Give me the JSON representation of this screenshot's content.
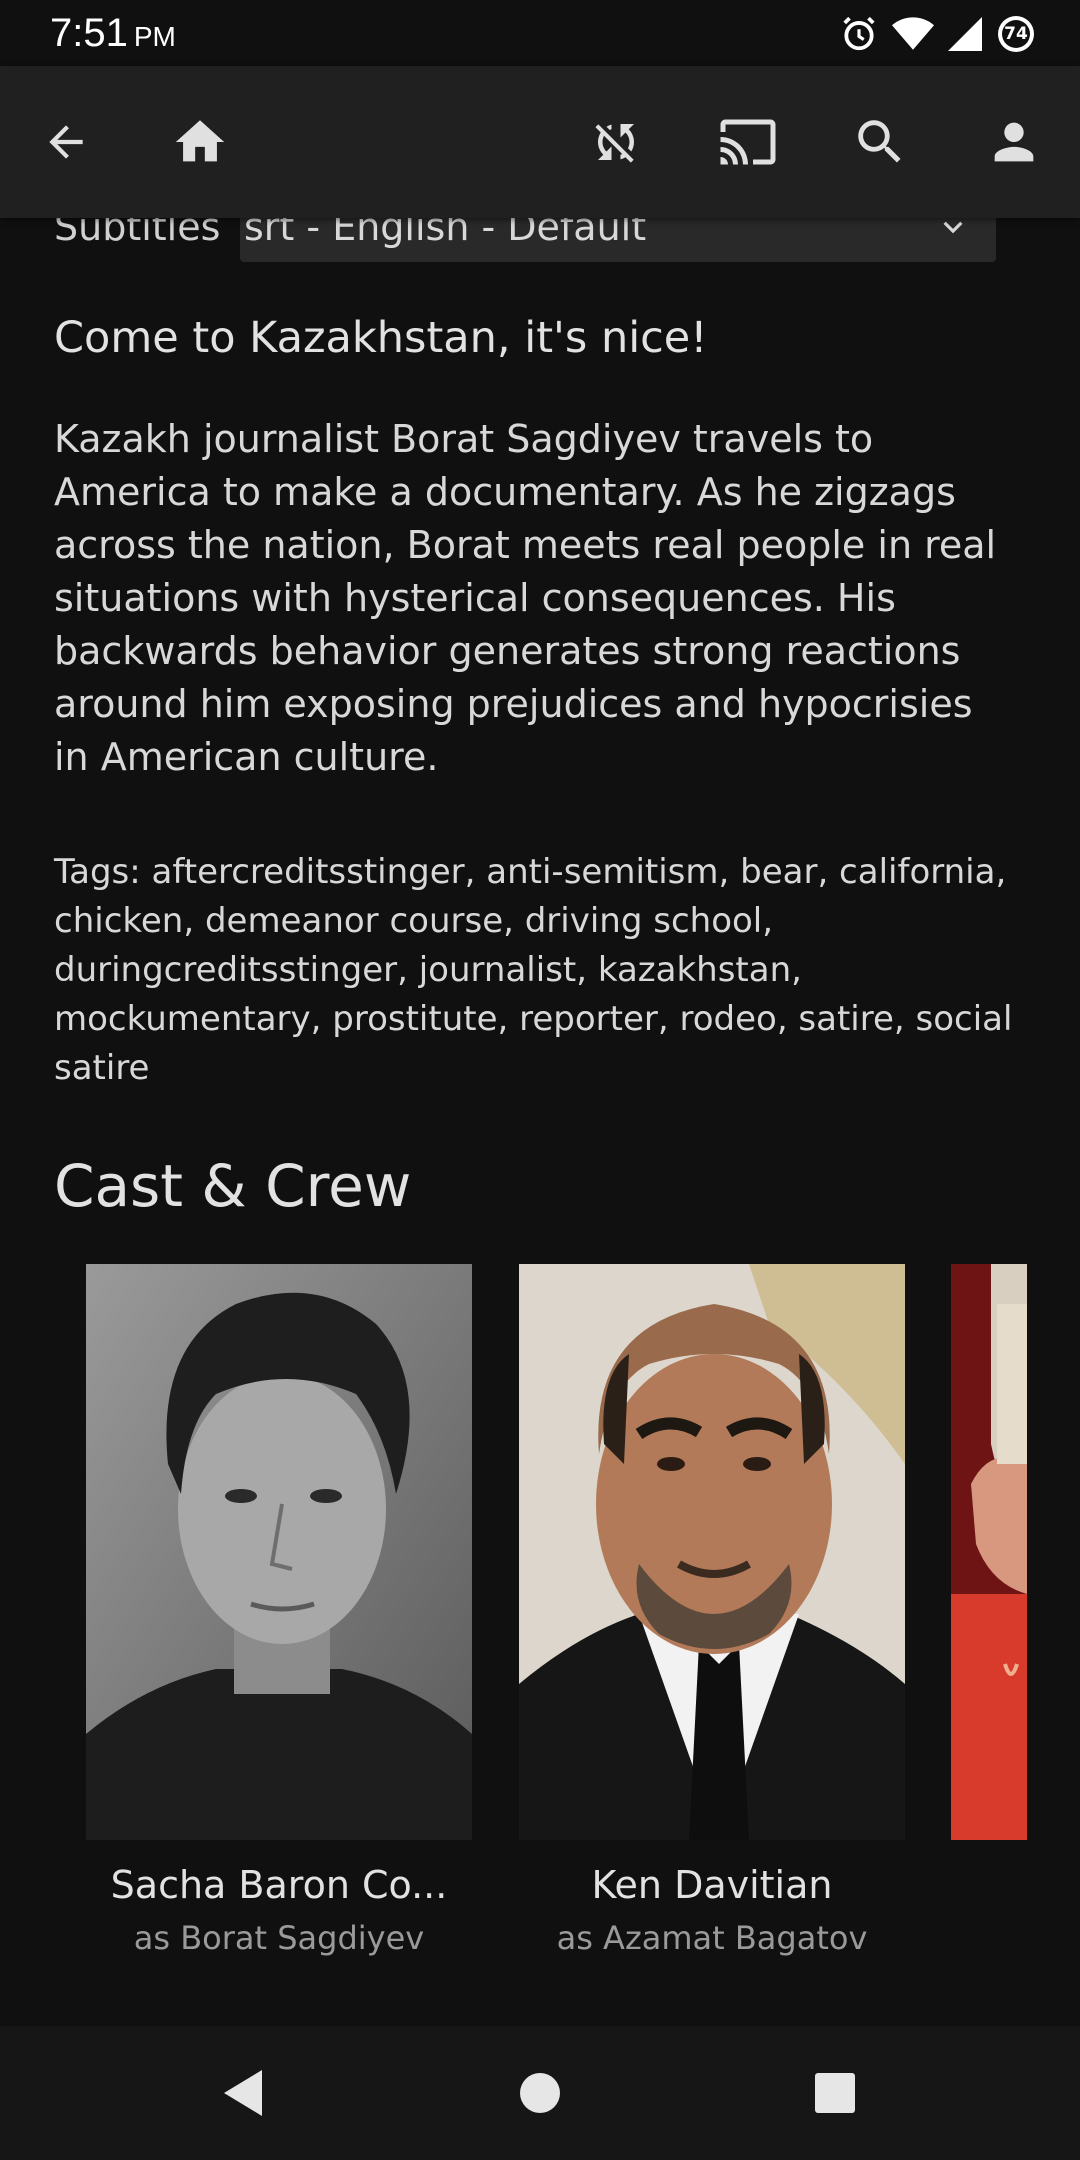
{
  "status_bar": {
    "time": "7:51",
    "ampm": "PM",
    "battery_level": "74"
  },
  "toolbar": {
    "back_icon": "arrow-back-icon",
    "home_icon": "home-icon",
    "sync_off_icon": "sync-disabled-icon",
    "cast_icon": "cast-icon",
    "search_icon": "search-icon",
    "account_icon": "account-icon"
  },
  "subtitles": {
    "label": "Subtitles",
    "selected": "srt - English - Default"
  },
  "tagline": "Come to Kazakhstan, it's nice!",
  "overview": "Kazakh journalist Borat Sagdiyev travels to America to make a documentary. As he zigzags across the nation, Borat meets real people in real situations with hysterical consequences. His backwards behavior generates strong reactions around him exposing prejudices and hypocrisies in American culture.",
  "tags": "Tags: aftercreditsstinger, anti-semitism, bear, california, chicken, demeanor course, driving school, duringcreditsstinger, journalist, kazakhstan, mockumentary, prostitute, reporter, rodeo, satire, social satire",
  "cast_section": {
    "title": "Cast & Crew",
    "people": [
      {
        "name": "Sacha Baron Co...",
        "role": "as Borat Sagdiyev"
      },
      {
        "name": "Ken Davitian",
        "role": "as Azamat Bagatov"
      },
      {
        "name": "",
        "role": ""
      }
    ]
  },
  "colors": {
    "background": "#101010",
    "app_bar": "#202020",
    "select_bg": "#292929",
    "text_primary": "#e2e2e2",
    "text_secondary": "#9a9a9a"
  }
}
